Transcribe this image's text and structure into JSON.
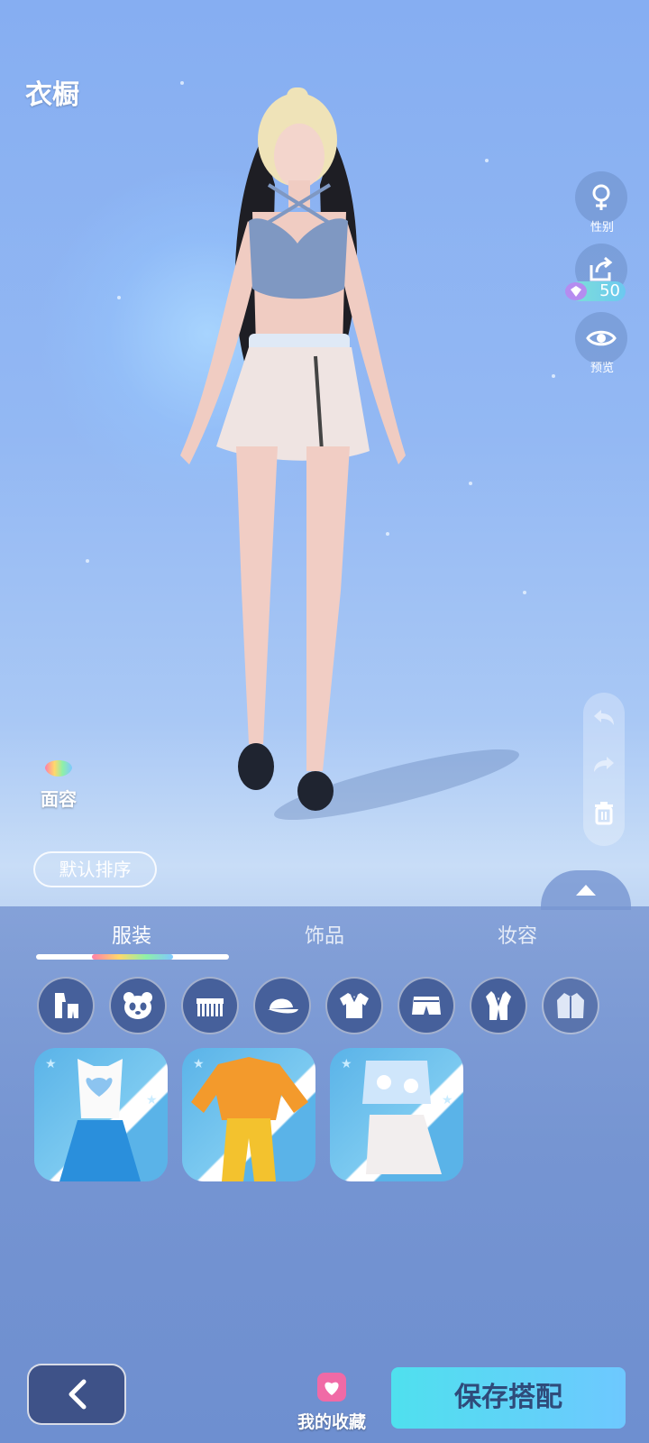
{
  "header": {
    "title": "衣橱"
  },
  "side_buttons": {
    "gender_label": "性别",
    "share_cost": "50",
    "preview_label": "预览"
  },
  "face_button": {
    "label": "面容"
  },
  "sort_button": {
    "label": "默认排序"
  },
  "tabs": [
    {
      "label": "服装",
      "active": true
    },
    {
      "label": "饰品",
      "active": false
    },
    {
      "label": "妆容",
      "active": false
    }
  ],
  "categories": [
    {
      "icon": "full-outfit-icon"
    },
    {
      "icon": "panda-icon"
    },
    {
      "icon": "comb-icon"
    },
    {
      "icon": "cap-icon"
    },
    {
      "icon": "shirt-icon"
    },
    {
      "icon": "shorts-icon"
    },
    {
      "icon": "suit-icon"
    },
    {
      "icon": "jacket-icon"
    }
  ],
  "items": [
    {
      "icon": "blue-heart-tank-skirt-outfit-icon"
    },
    {
      "icon": "orange-crop-top-yellow-pants-outfit-icon"
    },
    {
      "icon": "cloud-top-white-skirt-outfit-icon"
    }
  ],
  "bottom_bar": {
    "favorites_label": "我的收藏",
    "save_label": "保存搭配"
  },
  "colors": {
    "accent": "#4fe0ee",
    "panel": "#6e8fd0",
    "save_text": "#2f4b7a"
  }
}
